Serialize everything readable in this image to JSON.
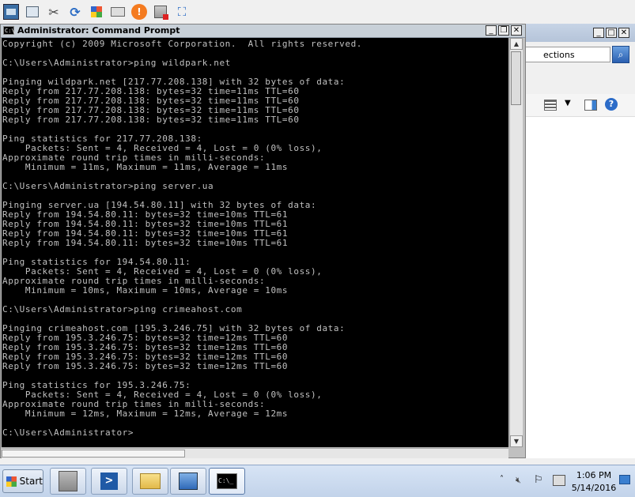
{
  "toolbar": {
    "icons": [
      "server-manager-icon",
      "mmc-icon",
      "tools-icon",
      "refresh-icon",
      "paint-icon",
      "drive-icon",
      "alert-icon",
      "remote-desktop-icon",
      "fullscreen-icon"
    ]
  },
  "cmd_window": {
    "title": "Administrator: Command Prompt",
    "minimize": "_",
    "restore": "❐",
    "close": "✕",
    "console_lines": [
      "Copyright (c) 2009 Microsoft Corporation.  All rights reserved.",
      "",
      "C:\\Users\\Administrator>ping wildpark.net",
      "",
      "Pinging wildpark.net [217.77.208.138] with 32 bytes of data:",
      "Reply from 217.77.208.138: bytes=32 time=11ms TTL=60",
      "Reply from 217.77.208.138: bytes=32 time=11ms TTL=60",
      "Reply from 217.77.208.138: bytes=32 time=11ms TTL=60",
      "Reply from 217.77.208.138: bytes=32 time=11ms TTL=60",
      "",
      "Ping statistics for 217.77.208.138:",
      "    Packets: Sent = 4, Received = 4, Lost = 0 (0% loss),",
      "Approximate round trip times in milli-seconds:",
      "    Minimum = 11ms, Maximum = 11ms, Average = 11ms",
      "",
      "C:\\Users\\Administrator>ping server.ua",
      "",
      "Pinging server.ua [194.54.80.11] with 32 bytes of data:",
      "Reply from 194.54.80.11: bytes=32 time=10ms TTL=61",
      "Reply from 194.54.80.11: bytes=32 time=10ms TTL=61",
      "Reply from 194.54.80.11: bytes=32 time=10ms TTL=61",
      "Reply from 194.54.80.11: bytes=32 time=10ms TTL=61",
      "",
      "Ping statistics for 194.54.80.11:",
      "    Packets: Sent = 4, Received = 4, Lost = 0 (0% loss),",
      "Approximate round trip times in milli-seconds:",
      "    Minimum = 10ms, Maximum = 10ms, Average = 10ms",
      "",
      "C:\\Users\\Administrator>ping crimeahost.com",
      "",
      "Pinging crimeahost.com [195.3.246.75] with 32 bytes of data:",
      "Reply from 195.3.246.75: bytes=32 time=12ms TTL=60",
      "Reply from 195.3.246.75: bytes=32 time=12ms TTL=60",
      "Reply from 195.3.246.75: bytes=32 time=12ms TTL=60",
      "Reply from 195.3.246.75: bytes=32 time=12ms TTL=60",
      "",
      "Ping statistics for 195.3.246.75:",
      "    Packets: Sent = 4, Received = 4, Lost = 0 (0% loss),",
      "Approximate round trip times in milli-seconds:",
      "    Minimum = 12ms, Maximum = 12ms, Average = 12ms",
      "",
      "C:\\Users\\Administrator>"
    ]
  },
  "background_window": {
    "search_value": "ections",
    "minimize": "_",
    "restore": "□",
    "close": "✕"
  },
  "taskbar": {
    "start_label": "Start",
    "clock_time": "1:06 PM",
    "clock_date": "5/14/2016"
  }
}
